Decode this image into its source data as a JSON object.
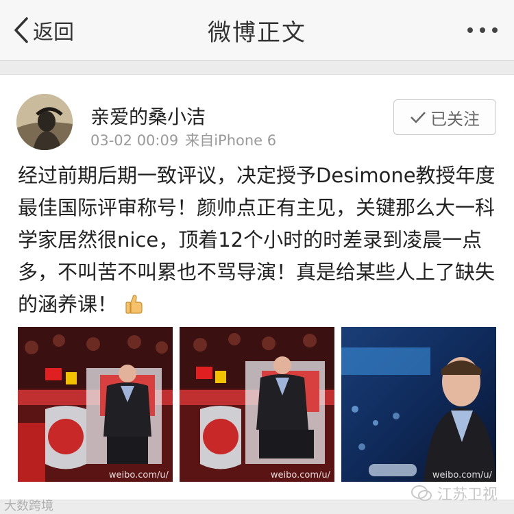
{
  "navbar": {
    "back_label": "返回",
    "title": "微博正文"
  },
  "post": {
    "username": "亲爱的桑小洁",
    "time": "03-02 00:09",
    "source": "来自iPhone 6",
    "follow_label": "已关注",
    "text": "经过前期后期一致评议，决定授予Desimone教授年度最佳国际评审称号！颜帅点正有主见，关键那么大一科学家居然很nice，顶着12个小时的时差录到凌晨一点多，不叫苦不叫累也不骂导演！真是给某些人上了缺失的涵养课！",
    "emoji": "thumbs-up-icon",
    "images": [
      {
        "watermark": "weibo.com/u/"
      },
      {
        "watermark": "weibo.com/u/"
      },
      {
        "watermark": "weibo.com/u/"
      }
    ]
  },
  "footer": {
    "left_watermark": "大数跨境",
    "right_watermark": "江苏卫视"
  }
}
